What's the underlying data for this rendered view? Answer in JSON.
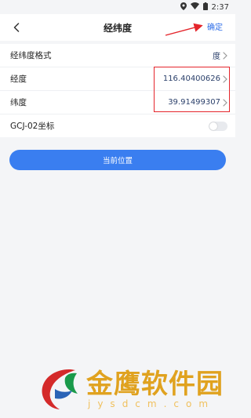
{
  "status_bar": {
    "time": "2:37"
  },
  "nav": {
    "title": "经纬度",
    "confirm_label": "确定"
  },
  "rows": [
    {
      "label": "经纬度格式",
      "value": "度"
    },
    {
      "label": "经度",
      "value": "116.40400626"
    },
    {
      "label": "纬度",
      "value": "39.91499307"
    },
    {
      "label": "GCJ-02坐标",
      "toggle_on": false
    }
  ],
  "location_button": {
    "label": "当前位置"
  },
  "watermark": {
    "brand": "金鹰软件园",
    "url": "jysdcm.com"
  },
  "colors": {
    "accent": "#3a7ef0",
    "annotation": "#e4252b",
    "watermark": "#e0a21f"
  },
  "icons": [
    "location-pin-icon",
    "wifi-icon",
    "battery-icon",
    "back-icon",
    "chevron-right-icon"
  ]
}
